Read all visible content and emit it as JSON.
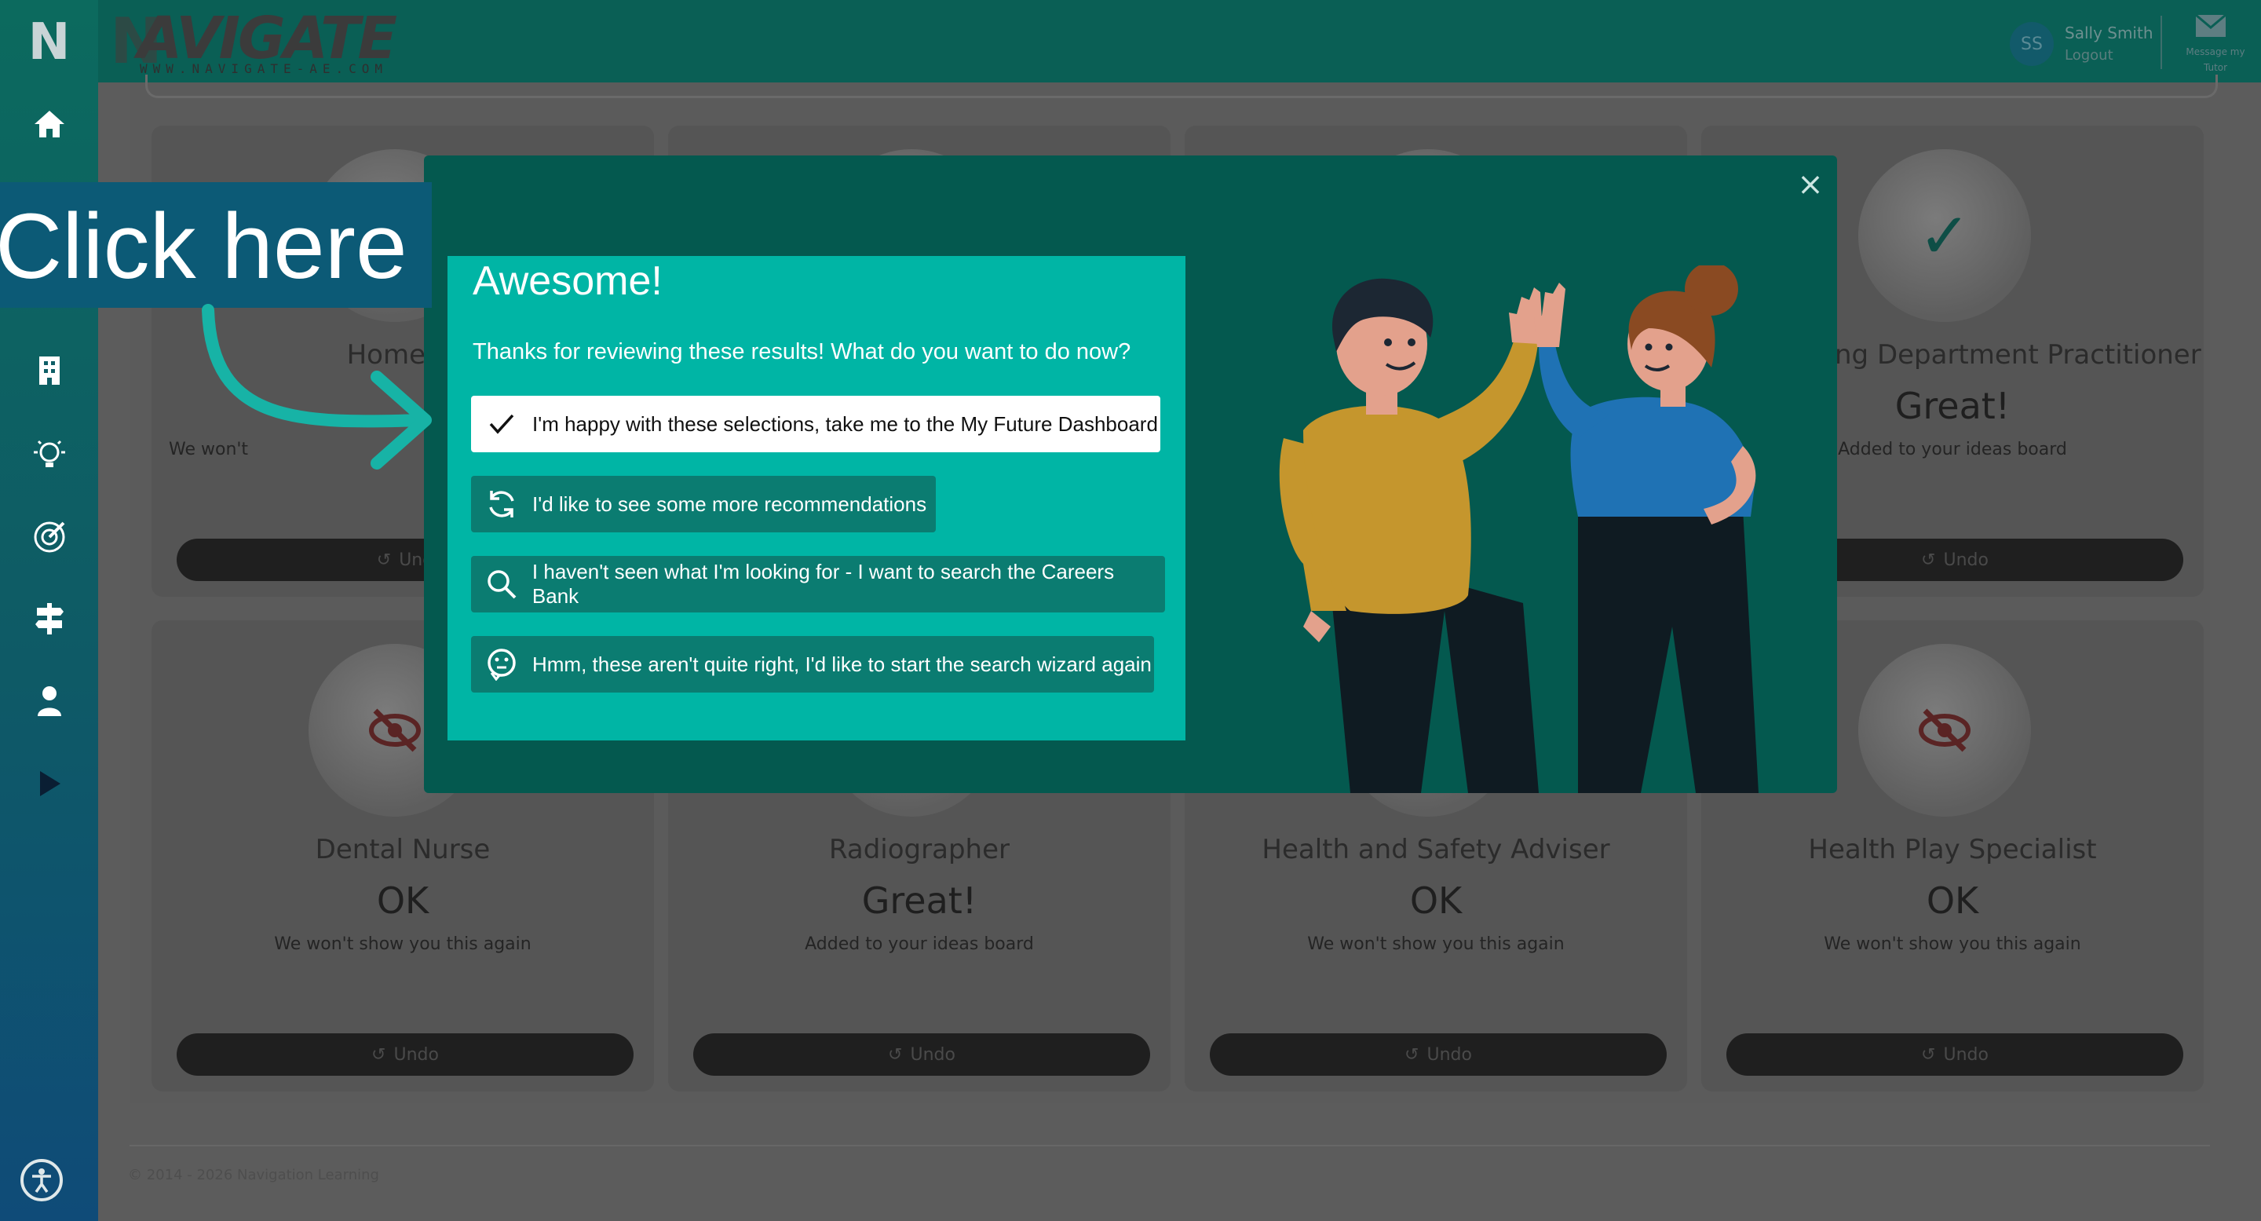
{
  "app": {
    "brand": "AVIGATE",
    "brand_initial": "N",
    "brand_tagline": "WWW.NAVIGATE-AE.COM",
    "user": {
      "initials": "SS",
      "name": "Sally Smith",
      "logout": "Logout"
    },
    "message_label": "Message my Tutor",
    "footer": "© 2014 - 2026 Navigation Learning"
  },
  "sidebar_icons": [
    "home-icon",
    "building-icon",
    "lightbulb-icon",
    "target-icon",
    "signpost-icon",
    "person-icon",
    "play-icon"
  ],
  "cards": [
    {
      "title": "Homeop",
      "status": "",
      "note": "We won't ",
      "undo": "Und"
    },
    {
      "title": "",
      "status": "",
      "note": "",
      "undo": ""
    },
    {
      "title": "",
      "status": "",
      "note": "",
      "undo": ""
    },
    {
      "title": "ng Department Practitioner",
      "status": "Great!",
      "note": "Added to your ideas board",
      "undo": "Undo"
    },
    {
      "title": "Dental Nurse",
      "status": "OK",
      "note": "We won't show you this again",
      "undo": "Undo"
    },
    {
      "title": "Radiographer",
      "status": "Great!",
      "note": "Added to your ideas board",
      "undo": "Undo"
    },
    {
      "title": "Health and Safety Adviser",
      "status": "OK",
      "note": "We won't show you this again",
      "undo": "Undo"
    },
    {
      "title": "Health Play Specialist",
      "status": "OK",
      "note": "We won't show you this again",
      "undo": "Undo"
    }
  ],
  "modal": {
    "close_glyph": "×",
    "title": "Awesome!",
    "subtitle": "Thanks for reviewing these results! What do you want to do now?",
    "options": [
      {
        "label": "I'm happy with these selections, take me to the My Future Dashboard",
        "icon": "check-icon"
      },
      {
        "label": "I'd like to see some more recommendations",
        "icon": "refresh-icon"
      },
      {
        "label": "I haven't seen what I'm looking for - I want to search the Careers Bank",
        "icon": "search-icon"
      },
      {
        "label": "Hmm, these aren't quite right, I'd like to start the search wizard again",
        "icon": "thinking-face-icon"
      }
    ]
  },
  "callout": {
    "text": "Click here"
  }
}
